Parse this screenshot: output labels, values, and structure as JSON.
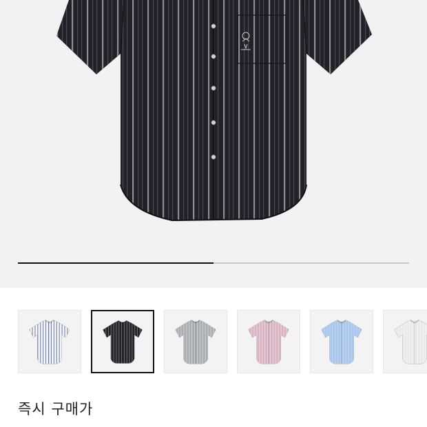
{
  "product_image": {
    "icon": "striped-short-sleeve-shirt-image",
    "colors": {
      "background": "#f2f2f2",
      "shirt": "#202228",
      "stripe_light": "#8c8d92",
      "stripe_dark": "#4a4c54"
    }
  },
  "gallery": {
    "progress_fraction": 0.5
  },
  "thumbnails": [
    {
      "color_name": "white-navy-stripe",
      "shirt": "#f7f7f9",
      "stripe": "#4a5a8a",
      "selected": false
    },
    {
      "color_name": "black-stripe",
      "shirt": "#22242a",
      "stripe": "#7d7e84",
      "selected": true
    },
    {
      "color_name": "grey-stripe",
      "shirt": "#a9acb1",
      "stripe": "#d7d9dc",
      "selected": false
    },
    {
      "color_name": "pink-stripe",
      "shirt": "#d9b3c3",
      "stripe": "#f1dde6",
      "selected": false
    },
    {
      "color_name": "light-blue",
      "shirt": "#a8c6ee",
      "stripe": "#c6dbf6",
      "selected": false
    },
    {
      "color_name": "white",
      "shirt": "#efefef",
      "stripe": "#e0e0e0",
      "selected": false
    }
  ],
  "buy_section": {
    "label": "즉시 구매가"
  }
}
